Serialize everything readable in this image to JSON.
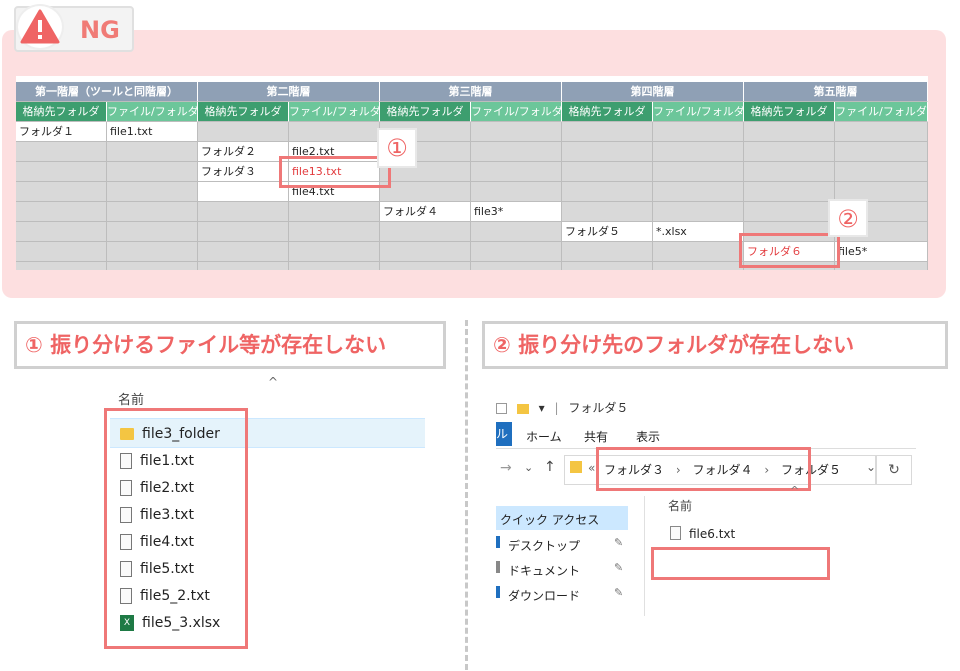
{
  "badge": {
    "label": "NG",
    "icon": "warning-icon"
  },
  "sheet": {
    "levels": [
      "第一階層（ツールと同階層）",
      "第二階層",
      "第三階層",
      "第四階層",
      "第五階層"
    ],
    "sub_headers": [
      "格納先フォルダ",
      "ファイル/フォルダ"
    ],
    "cells": {
      "r1c1": "フォルダ１",
      "r1c2": "file1.txt",
      "r2c3": "フォルダ２",
      "r2c4": "file2.txt",
      "r3c3": "フォルダ３",
      "r3c4": "file13.txt",
      "r4c4": "file4.txt",
      "r5c5": "フォルダ４",
      "r5c6": "file3*",
      "r6c7": "フォルダ５",
      "r6c8": "*.xlsx",
      "r7c9": "フォルダ６",
      "r7c10": "file5*"
    },
    "markers": [
      "①",
      "②"
    ]
  },
  "section1": {
    "title": "① 振り分けるファイル等が存在しない",
    "column_header": "名前",
    "sort_glyph": "^",
    "files": [
      "file3_folder",
      "file1.txt",
      "file2.txt",
      "file3.txt",
      "file4.txt",
      "file5.txt",
      "file5_2.txt",
      "file5_3.xlsx"
    ]
  },
  "section2": {
    "title": "② 振り分け先のフォルダが存在しない",
    "window_title": "フォルダ５",
    "qat_glyph": "▾",
    "ribbon_tabs": [
      "ホーム",
      "共有",
      "表示"
    ],
    "ribbon_file_tab": "ル",
    "breadcrumb": [
      "フォルダ３",
      "フォルダ４",
      "フォルダ５"
    ],
    "breadcrumb_prefix": "«",
    "column_header": "名前",
    "sidebar": {
      "quick_access": "クイック アクセス",
      "items": [
        "デスクトップ",
        "ドキュメント",
        "ダウンロード"
      ]
    },
    "files": [
      "file6.txt"
    ]
  },
  "colors": {
    "accent_red": "#ef6464",
    "ng_bg": "#fddfe0",
    "header_blue": "#8fa0b5",
    "header_green_dark": "#3d9e6f",
    "header_green_light": "#6cc69a"
  }
}
